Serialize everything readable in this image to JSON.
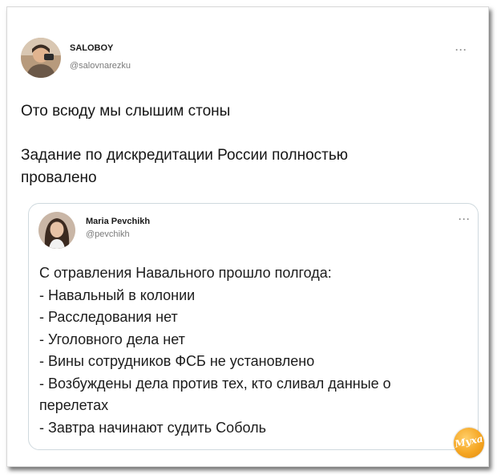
{
  "tweet": {
    "author_name": "SALOBOY",
    "author_handle": "@salovnarezku",
    "more_icon": "···",
    "lines": [
      "Ото всюду мы слышим стоны",
      "Задание по дискредитации России полностью",
      "провалено"
    ]
  },
  "quoted_tweet": {
    "author_name": "Maria Pevchikh",
    "author_handle": "@pevchikh",
    "more_icon": "···",
    "lines": [
      "С отравления Навального прошло полгода:",
      "- Навальный в колонии",
      "- Расследования нет",
      "- Уголовного дела нет",
      "- Вины сотрудников ФСБ не установлено",
      "- Возбуждены дела против тех, кто сливал данные о",
      "перелетах",
      "- Завтра начинают судить Соболь"
    ]
  },
  "watermark": {
    "text": "Муха",
    "icon": "site-logo-icon"
  }
}
